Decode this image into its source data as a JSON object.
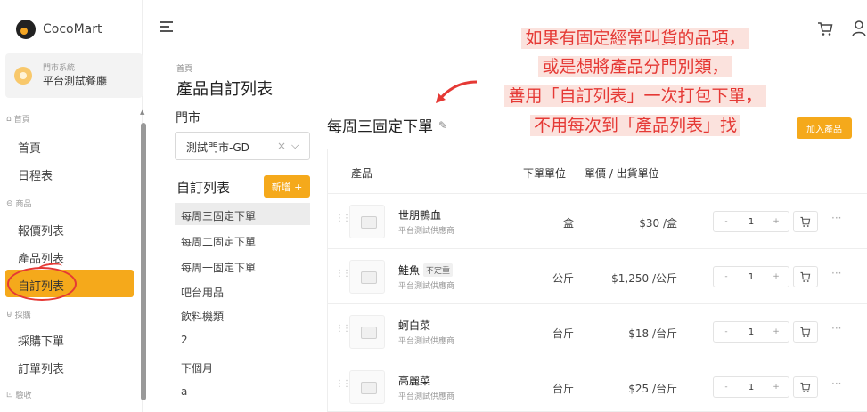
{
  "brand": {
    "name": "CocoMart"
  },
  "store": {
    "sub": "門市系統",
    "name": "平台測試餐廳"
  },
  "sidebar": {
    "sections": [
      {
        "label": "首頁",
        "icon": "home-icon"
      },
      {
        "label": "商品",
        "icon": "box-icon"
      },
      {
        "label": "採購",
        "icon": "cart-icon"
      },
      {
        "label": "驗收",
        "icon": "clipboard-icon"
      }
    ],
    "items": [
      "首頁",
      "日程表",
      "報價列表",
      "產品列表",
      "自訂列表",
      "採購下單",
      "訂單列表"
    ],
    "active": "自訂列表"
  },
  "page": {
    "breadcrumb": "首頁",
    "title": "產品自訂列表"
  },
  "store_filter": {
    "label": "門市",
    "value": "測試門市-GD",
    "clear": "×",
    "chevron": "⌵"
  },
  "custom_lists": {
    "title": "自訂列表",
    "new_label": "新增 +",
    "items": [
      "每周三固定下單",
      "每周二固定下單",
      "每周一固定下單",
      "吧台用品",
      "飲料機類",
      "2",
      "下個月",
      "a"
    ],
    "selected_index": 0
  },
  "current_list": {
    "name": "每周三固定下單",
    "add_label": "加入產品"
  },
  "table": {
    "headers": {
      "product": "產品",
      "unit": "下單單位",
      "price": "單價 / 出貨單位"
    },
    "rows": [
      {
        "name": "世朋鴨血",
        "tag": "",
        "supplier": "平台測試供應商",
        "unit": "盒",
        "price": "$30 /盒",
        "qty": "1"
      },
      {
        "name": "鮭魚",
        "tag": "不定重",
        "supplier": "平台測試供應商",
        "unit": "公斤",
        "price": "$1,250 /公斤",
        "qty": "1"
      },
      {
        "name": "蚵白菜",
        "tag": "",
        "supplier": "平台測試供應商",
        "unit": "台斤",
        "price": "$18 /台斤",
        "qty": "1"
      },
      {
        "name": "高麗菜",
        "tag": "",
        "supplier": "平台測試供應商",
        "unit": "台斤",
        "price": "$25 /台斤",
        "qty": "1"
      }
    ],
    "stepper": {
      "minus": "-",
      "plus": "+"
    },
    "more": "···"
  },
  "callout": {
    "lines": [
      "如果有固定經常叫貨的品項，",
      "或是想將產品分門別類，",
      "善用「自訂列表」一次打包下單，",
      "不用每次到「產品列表」找"
    ]
  },
  "colors": {
    "accent": "#f5a91b",
    "annotation": "#e53935",
    "highlight": "#fbe2dd"
  }
}
